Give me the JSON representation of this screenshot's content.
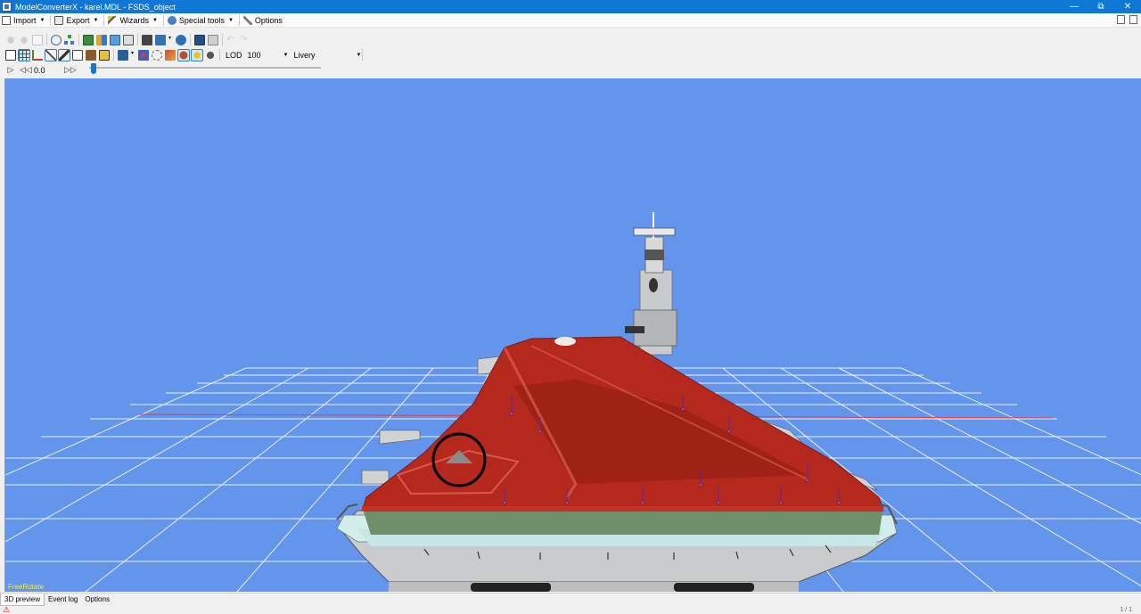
{
  "window": {
    "title": "ModelConverterX - karel.MDL - FSDS_object",
    "controls": [
      "minimize-icon",
      "restore-icon",
      "close-icon"
    ]
  },
  "menu": {
    "items": [
      {
        "label": "Import",
        "icon": "import-icon",
        "has_dropdown": true
      },
      {
        "label": "Export",
        "icon": "export-icon",
        "has_dropdown": true
      },
      {
        "label": "Wizards",
        "icon": "wand-icon",
        "has_dropdown": true
      },
      {
        "label": "Special tools",
        "icon": "gear-icon",
        "has_dropdown": true
      },
      {
        "label": "Options",
        "icon": "tools-icon",
        "has_dropdown": false
      }
    ]
  },
  "render_toolbar": {
    "lod_label": "LOD",
    "lod_value": "100",
    "livery_label": "Livery"
  },
  "animation": {
    "frame_value": "0.0",
    "slider_position": 0.0
  },
  "viewport": {
    "background_color": "#6495ED",
    "mode_label": "FreeRotate"
  },
  "tabs": [
    {
      "label": "3D preview",
      "active": true
    },
    {
      "label": "Event log",
      "active": false
    },
    {
      "label": "Options",
      "active": false
    }
  ],
  "status": {
    "page_indicator": "1 / 1"
  }
}
